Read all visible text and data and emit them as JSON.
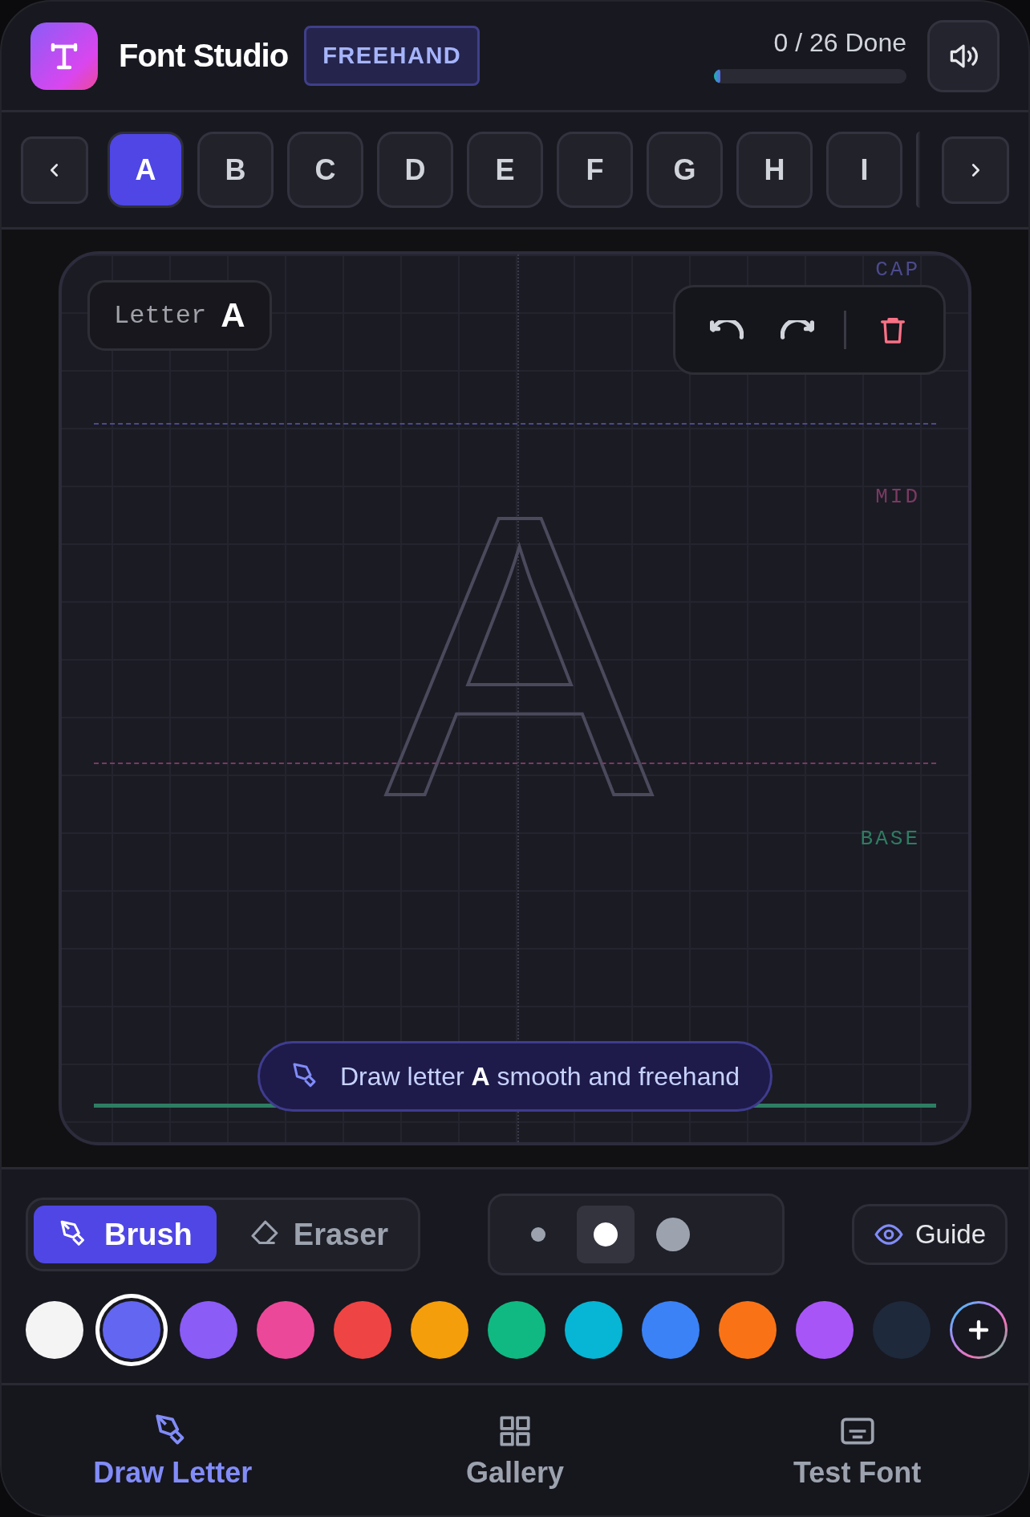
{
  "app": {
    "title": "Font Studio",
    "mode_badge": "FREEHAND"
  },
  "progress": {
    "label": "0 / 26 Done",
    "level": 0.02
  },
  "letters": [
    {
      "label": "A",
      "selected": true
    },
    {
      "label": "B",
      "selected": false
    },
    {
      "label": "C",
      "selected": false
    },
    {
      "label": "D",
      "selected": false
    },
    {
      "label": "E",
      "selected": false
    },
    {
      "label": "F",
      "selected": false
    },
    {
      "label": "G",
      "selected": false
    },
    {
      "label": "H",
      "selected": false
    },
    {
      "label": "I",
      "selected": false
    }
  ],
  "canvas": {
    "letter_label": "Letter",
    "letter": "A",
    "guide_letter": "A",
    "guides": [
      {
        "label": "CAP",
        "kind": "dashed",
        "color": "#4b4a8c"
      },
      {
        "label": "MID",
        "kind": "dashed",
        "color": "#7a3a62"
      },
      {
        "label": "BASE",
        "kind": "solid",
        "color": "#2e7d62"
      }
    ],
    "hint": "Draw letter **A** smooth and freehand"
  },
  "tools": [
    {
      "label": "Brush",
      "selected": true
    },
    {
      "label": "Eraser",
      "selected": false
    }
  ],
  "sizes": [
    {
      "selected": false
    },
    {
      "selected": true
    },
    {
      "selected": false
    }
  ],
  "guide_toggle": {
    "label": "Guide"
  },
  "palette": [
    {
      "color": "#f4f4f5",
      "selected": false
    },
    {
      "color": "#6366f1",
      "selected": true
    },
    {
      "color": "#8b5cf6",
      "selected": false
    },
    {
      "color": "#ec4899",
      "selected": false
    },
    {
      "color": "#ef4444",
      "selected": false
    },
    {
      "color": "#f59e0b",
      "selected": false
    },
    {
      "color": "#10b981",
      "selected": false
    },
    {
      "color": "#06b6d4",
      "selected": false
    },
    {
      "color": "#3b82f6",
      "selected": false
    },
    {
      "color": "#f97316",
      "selected": false
    },
    {
      "color": "#a855f7",
      "selected": false
    },
    {
      "color": "#1e293b",
      "selected": false
    }
  ],
  "nav": [
    {
      "label": "Draw Letter",
      "selected": true
    },
    {
      "label": "Gallery",
      "selected": false
    },
    {
      "label": "Test Font",
      "selected": false
    }
  ]
}
